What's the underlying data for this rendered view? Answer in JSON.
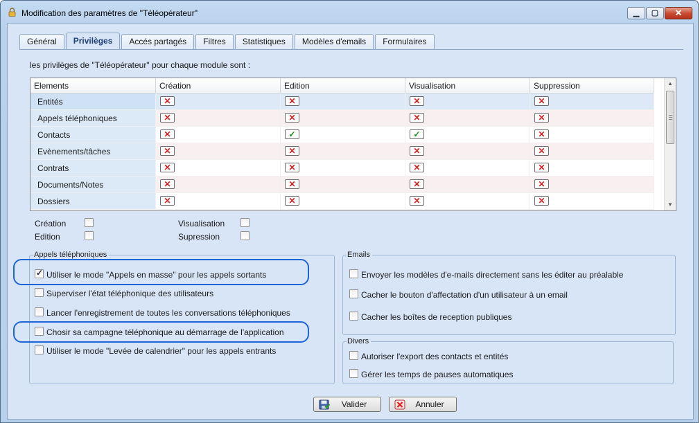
{
  "window": {
    "title": "Modification des paramètres de \"Téléopérateur\"",
    "controls": {
      "minimize": "▁",
      "maximize": "▢",
      "close": "✕"
    }
  },
  "tabs": [
    {
      "label": "Général",
      "active": false
    },
    {
      "label": "Privilèges",
      "active": true
    },
    {
      "label": "Accés partagés",
      "active": false
    },
    {
      "label": "Filtres",
      "active": false
    },
    {
      "label": "Statistiques",
      "active": false
    },
    {
      "label": "Modèles d'emails",
      "active": false
    },
    {
      "label": "Formulaires",
      "active": false
    }
  ],
  "intro": "les privilèges de \"Téléopérateur\" pour chaque module sont :",
  "table": {
    "columns": [
      "Elements",
      "Création",
      "Edition",
      "Visualisation",
      "Suppression"
    ],
    "rows": [
      {
        "name": "Entités",
        "values": [
          "no",
          "no",
          "no",
          "no"
        ]
      },
      {
        "name": "Appels téléphoniques",
        "values": [
          "no",
          "no",
          "no",
          "no"
        ]
      },
      {
        "name": "Contacts",
        "values": [
          "no",
          "yes",
          "yes",
          "no"
        ]
      },
      {
        "name": "Evènements/tâches",
        "values": [
          "no",
          "no",
          "no",
          "no"
        ]
      },
      {
        "name": "Contrats",
        "values": [
          "no",
          "no",
          "no",
          "no"
        ]
      },
      {
        "name": "Documents/Notes",
        "values": [
          "no",
          "no",
          "no",
          "no"
        ]
      },
      {
        "name": "Dossiers",
        "values": [
          "no",
          "no",
          "no",
          "no"
        ]
      }
    ],
    "glyph_no": "✕",
    "glyph_yes": "✓",
    "scroll_up": "▲",
    "scroll_down": "▼"
  },
  "bulk": {
    "creation": "Création",
    "edition": "Edition",
    "visualisation": "Visualisation",
    "suppression": "Supression"
  },
  "appels": {
    "title": "Appels téléphoniques",
    "items": [
      {
        "label": "Utiliser le mode \"Appels en masse\" pour les appels sortants",
        "checked": true
      },
      {
        "label": "Superviser l'état téléphonique des utilisateurs",
        "checked": false
      },
      {
        "label": "Lancer l'enregistrement de toutes les conversations téléphoniques",
        "checked": false
      },
      {
        "label": "Chosir sa campagne téléphonique au démarrage de l'application",
        "checked": false
      },
      {
        "label": "Utiliser le mode \"Levée de calendrier\" pour les appels entrants",
        "checked": false
      }
    ]
  },
  "emails": {
    "title": "Emails",
    "items": [
      {
        "label": "Envoyer les modèles d'e-mails directement sans les éditer au préalable",
        "checked": false
      },
      {
        "label": "Cacher le bouton d'affectation d'un utilisateur à un email",
        "checked": false
      },
      {
        "label": "Cacher les boîtes de reception publiques",
        "checked": false
      }
    ]
  },
  "divers": {
    "title": "Divers",
    "items": [
      {
        "label": "Autoriser l'export des contacts et entités",
        "checked": false
      },
      {
        "label": "Gérer les temps de pauses automatiques",
        "checked": false
      }
    ]
  },
  "buttons": {
    "validate": "Valider",
    "cancel": "Annuler"
  },
  "colors": {
    "highlight": "#1f64d6",
    "deny": "#d82020",
    "allow": "#1d8a1d"
  }
}
